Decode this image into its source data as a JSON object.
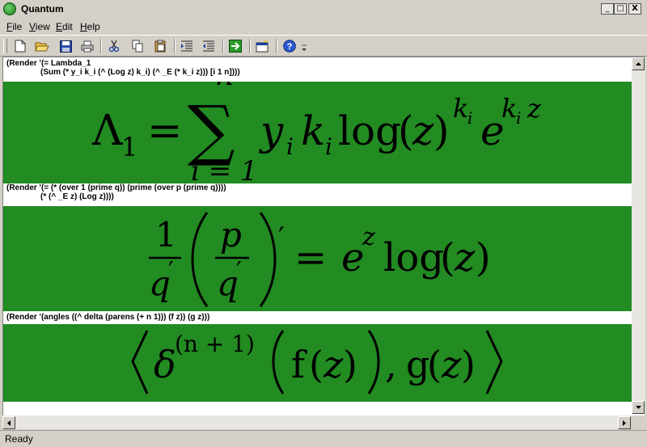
{
  "window": {
    "title": "Quantum",
    "min_glyph": "_",
    "max_glyph": "□",
    "close_glyph": "X"
  },
  "menu": [
    {
      "label": "File",
      "mnemonic": "F",
      "rest": "ile"
    },
    {
      "label": "View",
      "mnemonic": "V",
      "rest": "iew"
    },
    {
      "label": "Edit",
      "mnemonic": "E",
      "rest": "dit"
    },
    {
      "label": "Help",
      "mnemonic": "H",
      "rest": "elp"
    }
  ],
  "toolbar": {
    "icons": [
      "new-icon",
      "open-icon",
      "save-icon",
      "print-icon",
      "cut-icon",
      "copy-icon",
      "paste-icon",
      "indent-icon",
      "outdent-icon",
      "run-icon",
      "new-window-icon",
      "help-icon"
    ]
  },
  "cells": [
    {
      "code_line1": "(Render '(= Lambda_1",
      "code_line2": "(Sum (* y_i k_i (^ (Log z) k_i) (^ _E (* k_i z))) [i 1 n])))",
      "eq": {
        "lambda": "Λ",
        "sub1": "1",
        "equals": "=",
        "sum": "∑",
        "upper": "n",
        "lower": "i = 1",
        "y": "y",
        "i": "i",
        "k": "k",
        "log": "log",
        "open": "(",
        "z": "z",
        "close": ")",
        "e": "e"
      }
    },
    {
      "code_line1": "(Render '(= (* (over 1 (prime q)) (prime (over p (prime q))))",
      "code_line2": "(* (^ _E z) (Log z))))",
      "eq": {
        "one": "1",
        "q": "q",
        "prime": "′",
        "p": "p",
        "equals": "=",
        "e": "e",
        "z": "z",
        "log": "log",
        "open": "(",
        "close": ")"
      }
    },
    {
      "code_line1": "(Render '(angles ((^ delta (parens (+ n 1))) (f z)) (g z)))",
      "eq": {
        "langle": "⟨",
        "delta": "δ",
        "sup": "(n + 1)",
        "f": "f",
        "g": "g",
        "z": "z",
        "open": "(",
        "close": ")",
        "comma": ",",
        "rangle": "⟩"
      }
    }
  ],
  "colors": {
    "equation_bg": "#228b22",
    "chrome": "#d4d0c8"
  },
  "status": {
    "text": "Ready"
  }
}
